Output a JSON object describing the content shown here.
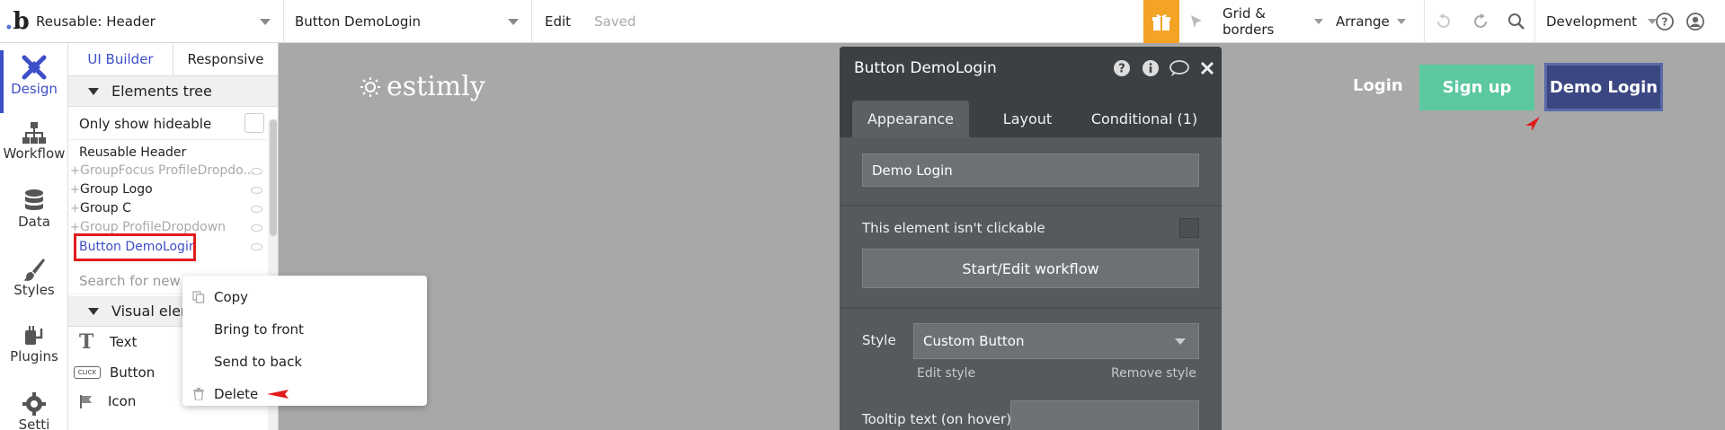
{
  "topbar": {
    "page_select": "Reusable: Header",
    "element_select": "Button DemoLogin",
    "edit": "Edit",
    "saved": "Saved",
    "grid_borders": "Grid & borders",
    "arrange": "Arrange",
    "environment": "Development",
    "accent_gift": "#f3a425"
  },
  "leftnav": {
    "items": [
      {
        "label": "Design",
        "icon": "design-icon",
        "active": true
      },
      {
        "label": "Workflow",
        "icon": "workflow-icon"
      },
      {
        "label": "Data",
        "icon": "data-icon"
      },
      {
        "label": "Styles",
        "icon": "styles-icon"
      },
      {
        "label": "Plugins",
        "icon": "plugins-icon"
      },
      {
        "label": "Setti",
        "icon": "settings-icon"
      }
    ]
  },
  "panel": {
    "tabs": [
      "UI Builder",
      "Responsive"
    ],
    "elements_tree": "Elements tree",
    "only_hideable": "Only show hideable",
    "tree": [
      {
        "label": "Reusable Header",
        "dim": false,
        "plus": false
      },
      {
        "label": "GroupFocus ProfileDropdo...",
        "dim": true,
        "plus": true
      },
      {
        "label": "Group Logo",
        "dim": false,
        "plus": true
      },
      {
        "label": "Group C",
        "dim": false,
        "plus": true
      },
      {
        "label": "Group ProfileDropdown",
        "dim": true,
        "plus": true
      },
      {
        "label": "Button DemoLogin",
        "dim": false,
        "plus": false,
        "selected": true
      }
    ],
    "search_placeholder": "Search for new e",
    "visual_elements": "Visual elem",
    "visual_items": [
      {
        "label": "Text",
        "icon": "text-icon"
      },
      {
        "label": "Button",
        "icon": "button-icon",
        "icon_text": "CLICK"
      },
      {
        "label": "Icon",
        "icon": "flag-icon"
      }
    ]
  },
  "context_menu": {
    "items": [
      {
        "label": "Copy",
        "icon": "copy-icon"
      },
      {
        "label": "Bring to front"
      },
      {
        "label": "Send to back"
      },
      {
        "label": "Delete",
        "icon": "trash-icon"
      }
    ]
  },
  "editor": {
    "title": "Button DemoLogin",
    "tabs": [
      "Appearance",
      "Layout",
      "Conditional (1)"
    ],
    "text_value": "Demo Login",
    "not_clickable": "This element isn't clickable",
    "workflow_button": "Start/Edit workflow",
    "style_label": "Style",
    "style_value": "Custom Button",
    "edit_style": "Edit style",
    "remove_style": "Remove style",
    "tooltip_label": "Tooltip text (on hover)"
  },
  "site": {
    "logo_text": "estimly",
    "login": "Login",
    "signup": "Sign up",
    "demo_login": "Demo Login",
    "signup_color": "#5bc8a0",
    "demo_color": "#3b4782"
  }
}
